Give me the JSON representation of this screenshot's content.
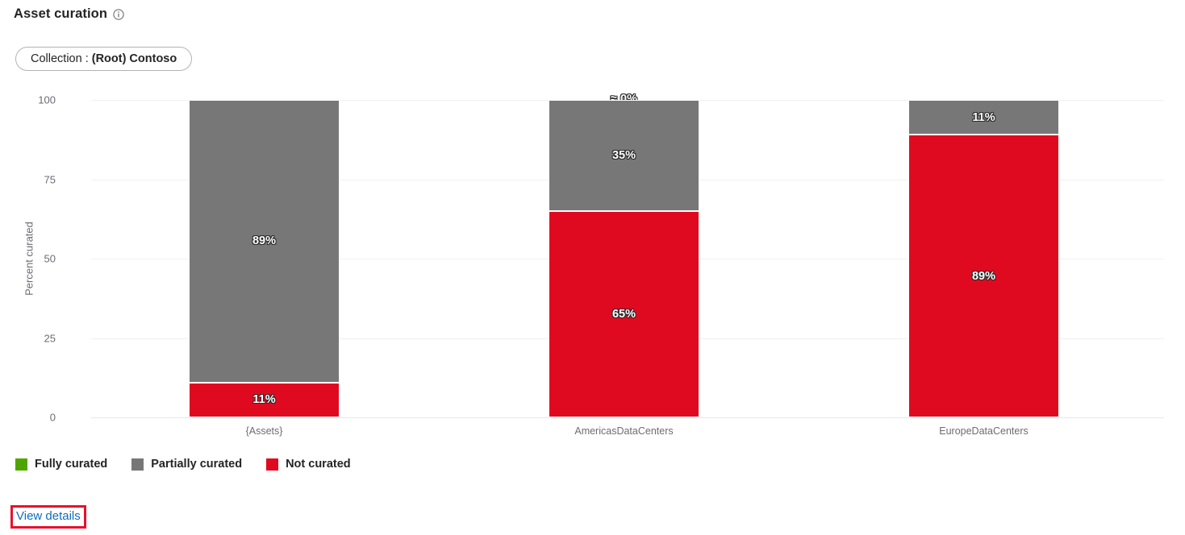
{
  "header": {
    "title": "Asset curation",
    "info_icon": "info-circle-icon"
  },
  "filter": {
    "label": "Collection :",
    "value": "(Root) Contoso"
  },
  "footer": {
    "view_details_label": "View details",
    "highlight_color": "#e8112d"
  },
  "colors": {
    "fully_curated": "#4fa500",
    "partially_curated": "#777777",
    "not_curated": "#e00a20",
    "gridline": "#f0f0f0",
    "baseline": "#e4e8f2",
    "link": "#0f6cbd",
    "axis_text": "#6b6b76"
  },
  "chart_data": {
    "type": "bar",
    "title": "Asset curation",
    "stacked": true,
    "stack_total": 100,
    "xlabel": "",
    "ylabel": "Percent curated",
    "ylim": [
      0,
      100
    ],
    "yticks": [
      "0",
      "25",
      "50",
      "75",
      "100"
    ],
    "ytick_values": [
      0,
      25,
      50,
      75,
      100
    ],
    "grid": true,
    "legend_position": "bottom-left",
    "categories": [
      "{Assets}",
      "AmericasDataCenters",
      "EuropeDataCenters"
    ],
    "series": [
      {
        "name": "Fully curated",
        "color": "#4fa500",
        "values": [
          0,
          0.4,
          0
        ],
        "labels": [
          "",
          "≈ 0%",
          ""
        ]
      },
      {
        "name": "Partially curated",
        "color": "#777777",
        "values": [
          89,
          35,
          11
        ],
        "labels": [
          "89%",
          "35%",
          "11%"
        ]
      },
      {
        "name": "Not curated",
        "color": "#e00a20",
        "values": [
          11,
          65,
          89
        ],
        "labels": [
          "11%",
          "65%",
          "89%"
        ]
      }
    ],
    "legend": [
      {
        "label": "Fully curated",
        "color": "#4fa500"
      },
      {
        "label": "Partially curated",
        "color": "#777777"
      },
      {
        "label": "Not curated",
        "color": "#e00a20"
      }
    ]
  }
}
